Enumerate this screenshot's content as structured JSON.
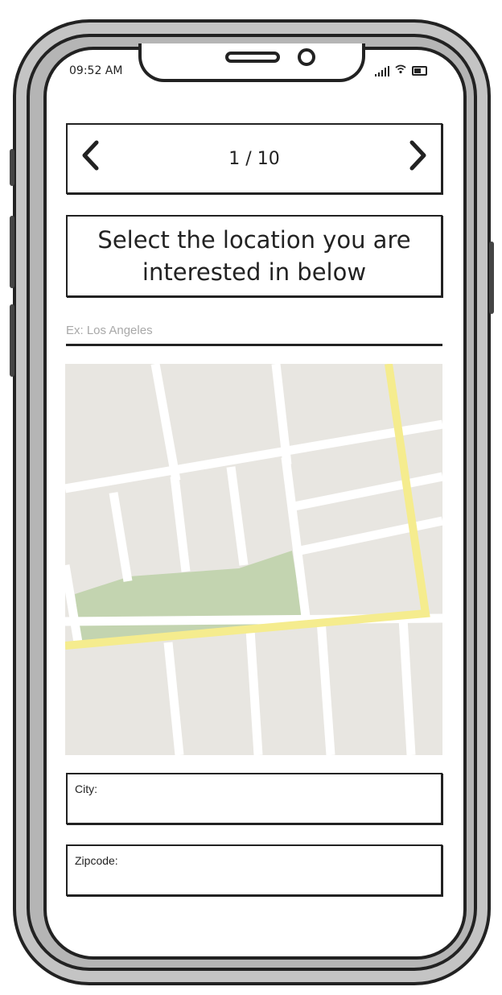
{
  "status_bar": {
    "time": "09:52 AM"
  },
  "pager": {
    "prev_icon": "chevron-left",
    "next_icon": "chevron-right",
    "current": "1 / 10"
  },
  "heading": "Select the location you are interested in below",
  "search": {
    "placeholder": "Ex: Los Angeles",
    "value": ""
  },
  "map": {
    "colors": {
      "block": "#e8e6e1",
      "road": "#ffffff",
      "highway": "#f5ec8e",
      "park": "#c3d4b0"
    }
  },
  "form": {
    "city_label": "City:",
    "city_value": "",
    "zip_label": "Zipcode:",
    "zip_value": ""
  }
}
